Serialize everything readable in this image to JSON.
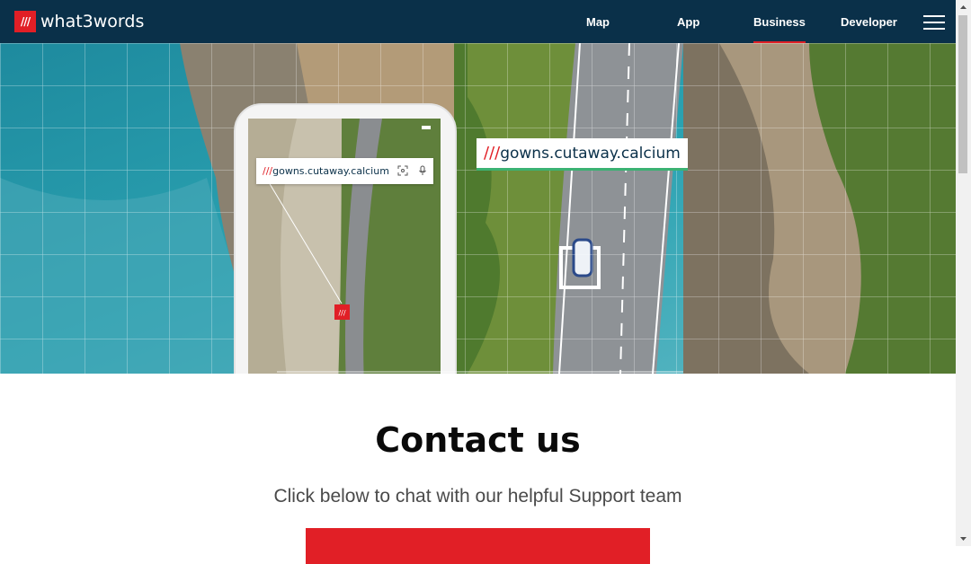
{
  "header": {
    "logo_mark": "///",
    "logo_text": "what3words",
    "nav": [
      {
        "label": "Map",
        "active": false
      },
      {
        "label": "App",
        "active": false
      },
      {
        "label": "Business",
        "active": true
      },
      {
        "label": "Developer",
        "active": false
      }
    ],
    "menu_icon": "hamburger-icon"
  },
  "hero": {
    "phone_slashes": "///",
    "phone_address": "gowns.cutaway.calcium",
    "label_slashes": "///",
    "label_address": "gowns.cutaway.calcium",
    "pin_mark": "///"
  },
  "contact": {
    "title": "Contact us",
    "subtitle": "Click below to chat with our helpful Support team",
    "button_label": ""
  },
  "colors": {
    "brand_red": "#e11f26",
    "header_navy": "#0a3049",
    "label_underline": "#3bb273"
  }
}
